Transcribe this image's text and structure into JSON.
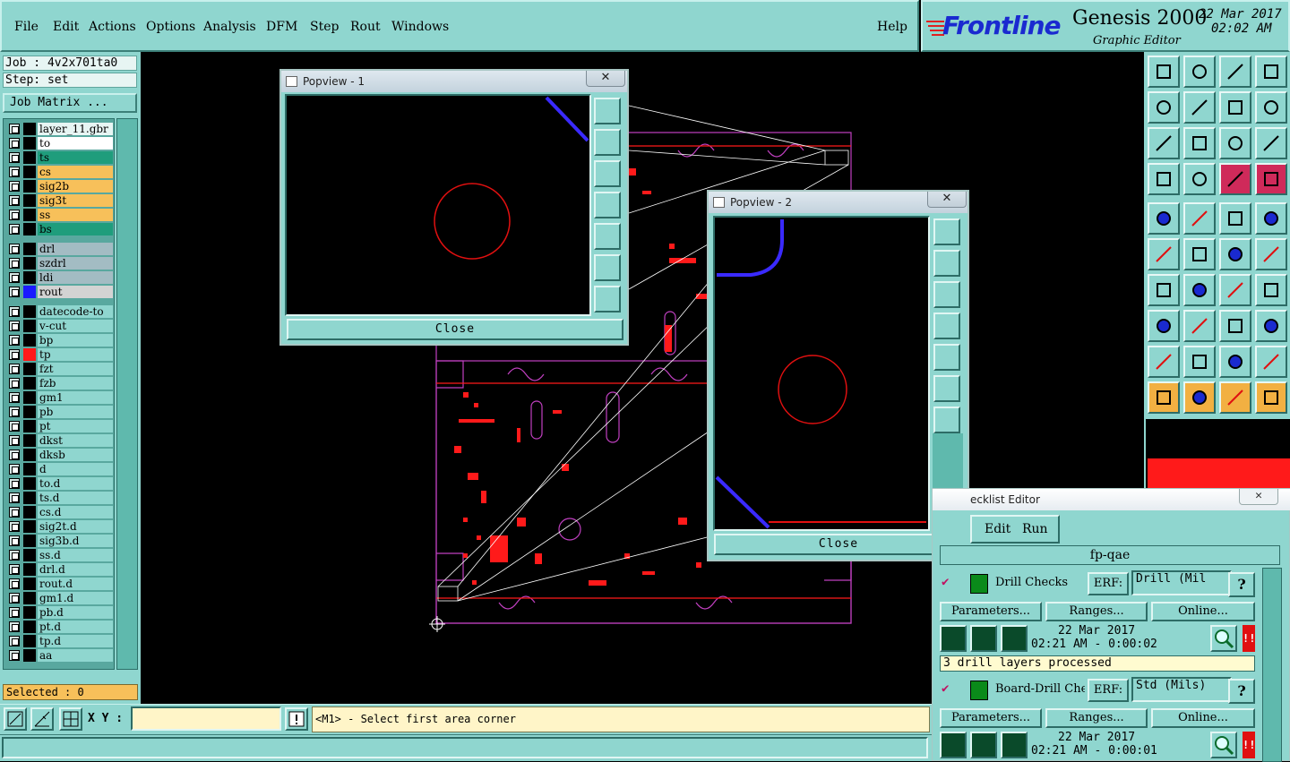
{
  "menu": [
    "File",
    "Edit",
    "Actions",
    "Options",
    "Analysis",
    "DFM",
    "Step",
    "Rout",
    "Windows"
  ],
  "help": "Help",
  "brand": {
    "logo": "Frontline",
    "product": "Genesis 2000",
    "subtitle": "Graphic Editor",
    "date": "22 Mar 2017",
    "time": "02:02 AM"
  },
  "job": {
    "label": "Job : 4v2x701ta0",
    "step": "Step: set",
    "matrix_button": "Job Matrix ..."
  },
  "layers": [
    {
      "name": "layer_11.gbr",
      "bg": "#e7f5f3",
      "swatch": "#000"
    },
    {
      "name": "to",
      "bg": "#ffffff",
      "swatch": "#000"
    },
    {
      "name": "ts",
      "bg": "#1f9d7c",
      "swatch": "#000"
    },
    {
      "name": "cs",
      "bg": "#f7c05a",
      "swatch": "#000"
    },
    {
      "name": "sig2b",
      "bg": "#f7c05a",
      "swatch": "#000"
    },
    {
      "name": "sig3t",
      "bg": "#f7c05a",
      "swatch": "#000"
    },
    {
      "name": "ss",
      "bg": "#f7c05a",
      "swatch": "#000"
    },
    {
      "name": "bs",
      "bg": "#1f9d7c",
      "swatch": "#000"
    },
    {
      "name": "drl",
      "bg": "#a3bcc3",
      "swatch": "#000"
    },
    {
      "name": "szdrl",
      "bg": "#a3bcc3",
      "swatch": "#000"
    },
    {
      "name": "ldi",
      "bg": "#a3bcc3",
      "swatch": "#000"
    },
    {
      "name": "rout",
      "bg": "#d3d3d3",
      "swatch": "#1a1aff"
    },
    {
      "name": "datecode-to",
      "bg": "#8fd6cf",
      "swatch": "#000"
    },
    {
      "name": "v-cut",
      "bg": "#8fd6cf",
      "swatch": "#000"
    },
    {
      "name": "bp",
      "bg": "#8fd6cf",
      "swatch": "#000"
    },
    {
      "name": "tp",
      "bg": "#8fd6cf",
      "swatch": "#ff1a1a"
    },
    {
      "name": "fzt",
      "bg": "#8fd6cf",
      "swatch": "#000"
    },
    {
      "name": "fzb",
      "bg": "#8fd6cf",
      "swatch": "#000"
    },
    {
      "name": "gm1",
      "bg": "#8fd6cf",
      "swatch": "#000"
    },
    {
      "name": "pb",
      "bg": "#8fd6cf",
      "swatch": "#000"
    },
    {
      "name": "pt",
      "bg": "#8fd6cf",
      "swatch": "#000"
    },
    {
      "name": "dkst",
      "bg": "#8fd6cf",
      "swatch": "#000"
    },
    {
      "name": "dksb",
      "bg": "#8fd6cf",
      "swatch": "#000"
    },
    {
      "name": "d",
      "bg": "#8fd6cf",
      "swatch": "#000"
    },
    {
      "name": "to.d",
      "bg": "#8fd6cf",
      "swatch": "#000"
    },
    {
      "name": "ts.d",
      "bg": "#8fd6cf",
      "swatch": "#000"
    },
    {
      "name": "cs.d",
      "bg": "#8fd6cf",
      "swatch": "#000"
    },
    {
      "name": "sig2t.d",
      "bg": "#8fd6cf",
      "swatch": "#000"
    },
    {
      "name": "sig3b.d",
      "bg": "#8fd6cf",
      "swatch": "#000"
    },
    {
      "name": "ss.d",
      "bg": "#8fd6cf",
      "swatch": "#000"
    },
    {
      "name": "drl.d",
      "bg": "#8fd6cf",
      "swatch": "#000"
    },
    {
      "name": "rout.d",
      "bg": "#8fd6cf",
      "swatch": "#000"
    },
    {
      "name": "gm1.d",
      "bg": "#8fd6cf",
      "swatch": "#000"
    },
    {
      "name": "pb.d",
      "bg": "#8fd6cf",
      "swatch": "#000"
    },
    {
      "name": "pt.d",
      "bg": "#8fd6cf",
      "swatch": "#000"
    },
    {
      "name": "tp.d",
      "bg": "#8fd6cf",
      "swatch": "#000"
    },
    {
      "name": "aa",
      "bg": "#8fd6cf",
      "swatch": "#000"
    }
  ],
  "selected": "Selected : 0",
  "xy_label": "X Y :",
  "xy_value": "",
  "prompt": "<M1> - Select first area corner",
  "popview1": {
    "title": "Popview - 1",
    "close": "Close",
    "x": "✕"
  },
  "popview2": {
    "title": "Popview - 2",
    "close": "Close",
    "x": "✕"
  },
  "checklist": {
    "title": "ecklist Editor",
    "menu_edit": "Edit",
    "menu_run": "Run",
    "name": "fp-qae",
    "items": [
      {
        "label": "Drill Checks",
        "erf_label": "ERF:",
        "erf_value": "Drill (Mil",
        "help": "?",
        "parameters": "Parameters...",
        "ranges": "Ranges...",
        "online": "Online...",
        "date": "22 Mar 2017",
        "time": "02:21 AM - 0:00:02",
        "message": "3 drill layers processed"
      },
      {
        "label": "Board-Drill Che",
        "erf_label": "ERF:",
        "erf_value": "Std (Mils)",
        "help": "?",
        "parameters": "Parameters...",
        "ranges": "Ranges...",
        "online": "Online...",
        "date": "22 Mar 2017",
        "time": "02:21 AM - 0:00:01"
      }
    ]
  },
  "colors": {
    "panel": "#8fd6cf",
    "highlight": "#f7c05a",
    "outline": "#c040c0",
    "copper": "#ff1a1a",
    "rout": "#3a2aff"
  }
}
